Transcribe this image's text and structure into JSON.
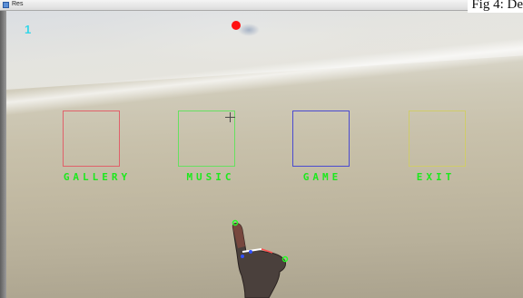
{
  "window": {
    "title": "Res"
  },
  "caption_overlay": "Fig 4: De",
  "hud": {
    "counter": "1"
  },
  "menu": {
    "items": [
      {
        "id": "gallery",
        "label": "GALLERY",
        "border_color": "#e0606a"
      },
      {
        "id": "music",
        "label": "MUSIC",
        "border_color": "#66e060"
      },
      {
        "id": "game",
        "label": "GAME",
        "border_color": "#4a4ad0"
      },
      {
        "id": "exit",
        "label": "EXIT",
        "border_color": "#cfcc6a"
      }
    ],
    "label_color": "#1de81d"
  },
  "indicators": {
    "cursor_dot_color": "#ff1010",
    "counter_color": "#36d6e8"
  },
  "icons": {
    "crosshair": "crosshair-icon",
    "app": "app-icon"
  }
}
